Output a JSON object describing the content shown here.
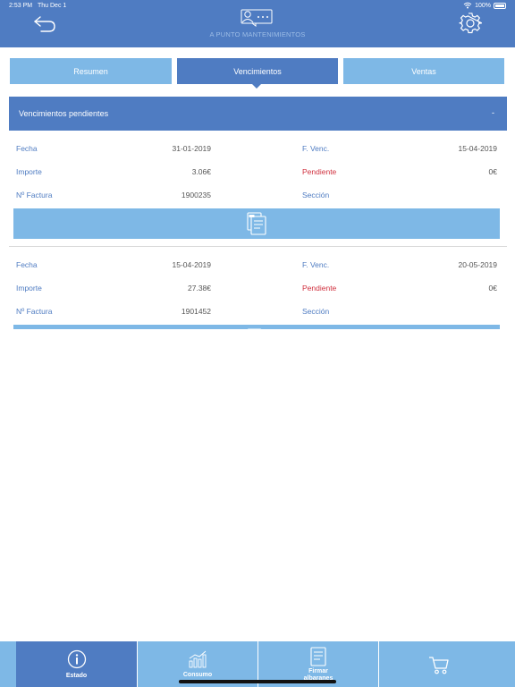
{
  "status_bar": {
    "time": "2:53 PM",
    "date": "Thu Dec 1",
    "battery": "100%"
  },
  "header": {
    "app_title": "A PUNTO MANTENIMIENTOS"
  },
  "tabs": [
    {
      "label": "Resumen",
      "active": false
    },
    {
      "label": "Vencimientos",
      "active": true
    },
    {
      "label": "Ventas",
      "active": false
    }
  ],
  "section": {
    "title": "Vencimientos pendientes",
    "toggle": "-"
  },
  "records": [
    {
      "fecha_label": "Fecha",
      "fecha": "31-01-2019",
      "fvenc_label": "F. Venc.",
      "fvenc": "15-04-2019",
      "importe_label": "Importe",
      "importe": "3.06€",
      "pendiente_label": "Pendiente",
      "pendiente": "0€",
      "factura_label": "Nº Factura",
      "factura": "1900235",
      "seccion_label": "Sección"
    },
    {
      "fecha_label": "Fecha",
      "fecha": "15-04-2019",
      "fvenc_label": "F. Venc.",
      "fvenc": "20-05-2019",
      "importe_label": "Importe",
      "importe": "27.38€",
      "pendiente_label": "Pendiente",
      "pendiente": "0€",
      "factura_label": "Nº Factura",
      "factura": "1901452",
      "seccion_label": "Sección"
    }
  ],
  "bottom_tabs": [
    {
      "label": "Estado",
      "icon": "info-icon",
      "active": true
    },
    {
      "label": "Consumo",
      "icon": "bar-chart-icon",
      "active": false
    },
    {
      "label_line1": "Firmar",
      "label_line2": "albaranes",
      "icon": "document-sign-icon",
      "active": false
    },
    {
      "label": "",
      "icon": "cart-icon",
      "active": false
    }
  ],
  "colors": {
    "primary": "#4f7cc2",
    "light": "#7eb8e6",
    "label": "#4f7cc2",
    "alert": "#d0313f",
    "value": "#555555"
  }
}
